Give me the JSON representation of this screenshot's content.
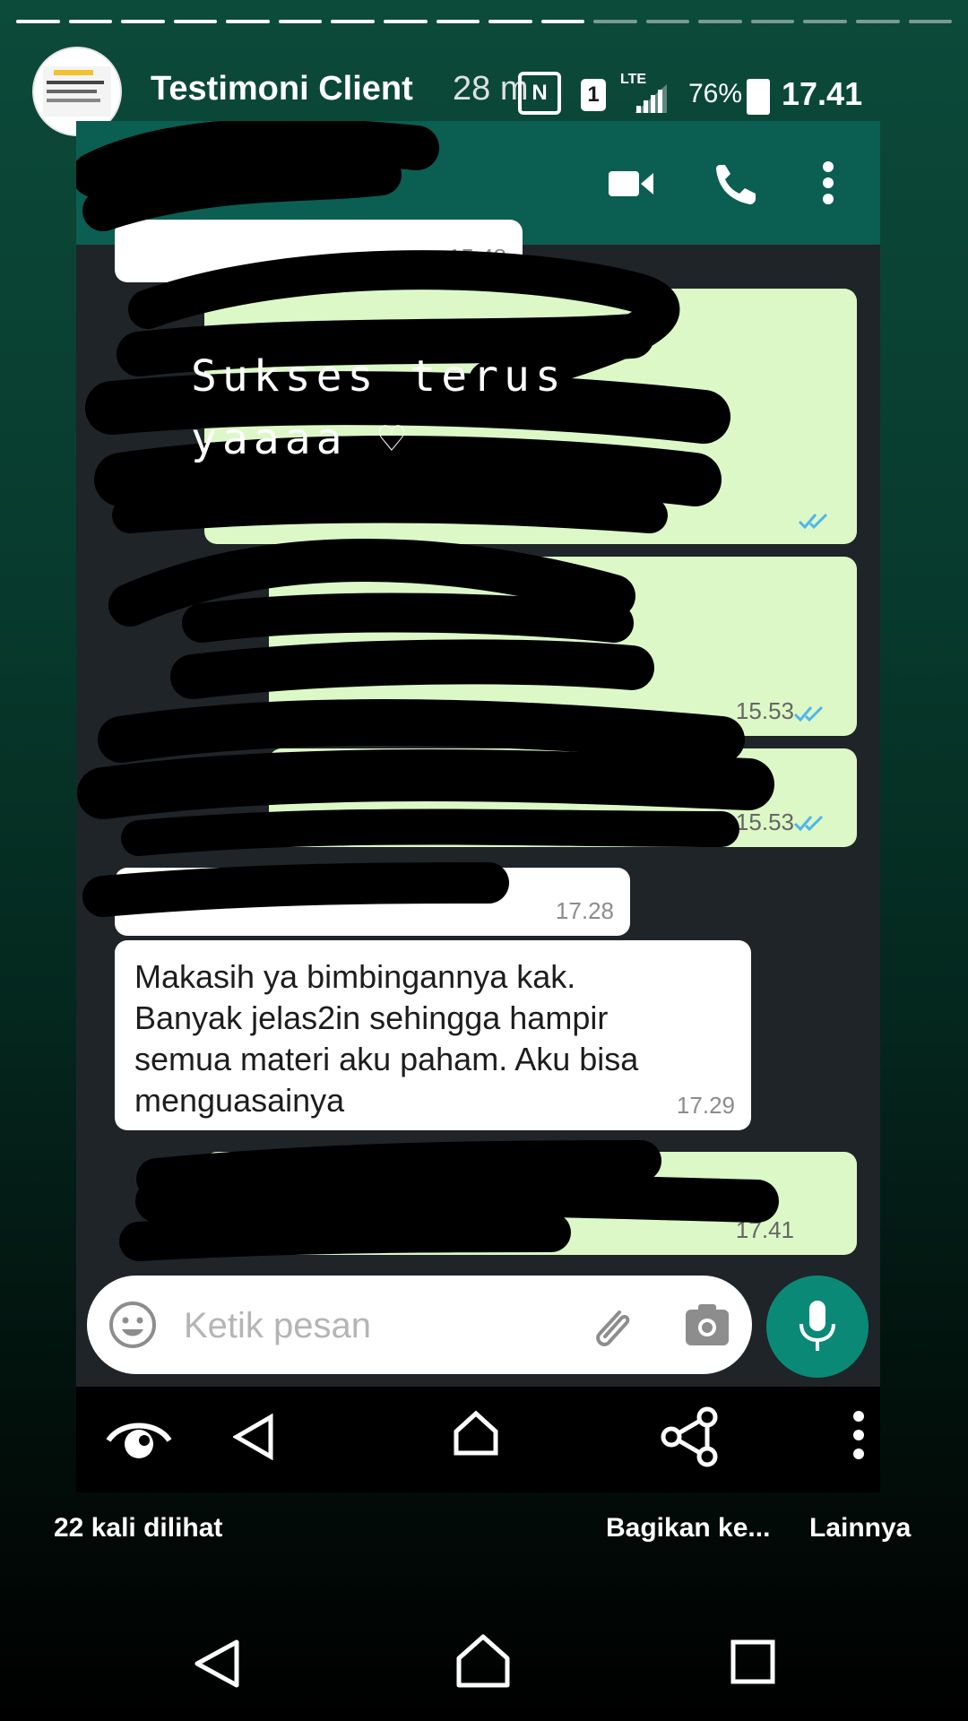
{
  "story": {
    "title": "Testimoni Client",
    "time_ago": "28 m",
    "progress_total": 18,
    "progress_done": 11,
    "views_label": "22 kali dilihat",
    "share_label": "Bagikan ke...",
    "more_label": "Lainnya"
  },
  "status_bar": {
    "nfc": "N",
    "sim": "1",
    "network": "LTE",
    "battery": "76%",
    "clock": "17.41"
  },
  "chat": {
    "sticker_text": "Sukses terus\nyaaaa ♡",
    "time_top": "15.48",
    "time_in_1": "17.28",
    "message_in_2": "Makasih ya bimbingannya kak.\nBanyak jelas2in sehingga hampir\nsemua materi aku paham. Aku bisa\nmenguasainya",
    "time_in_2": "17.29",
    "time_out_1": "15.53",
    "time_out_2": "15.53",
    "time_out_3": "17.41",
    "input_placeholder": "Ketik pesan"
  },
  "colors": {
    "wa_header": "#0b5e52",
    "bubble_out": "#dcf8c6",
    "bubble_in": "#ffffff",
    "mic_button": "#0a8a76",
    "read_tick": "#4fb6ec"
  },
  "icons": [
    "back-icon",
    "video-call-icon",
    "voice-call-icon",
    "more-vert-icon",
    "emoji-icon",
    "attach-icon",
    "camera-icon",
    "mic-icon",
    "eye-icon",
    "nav-back-icon",
    "nav-home-icon",
    "share-icon",
    "more-icon"
  ]
}
